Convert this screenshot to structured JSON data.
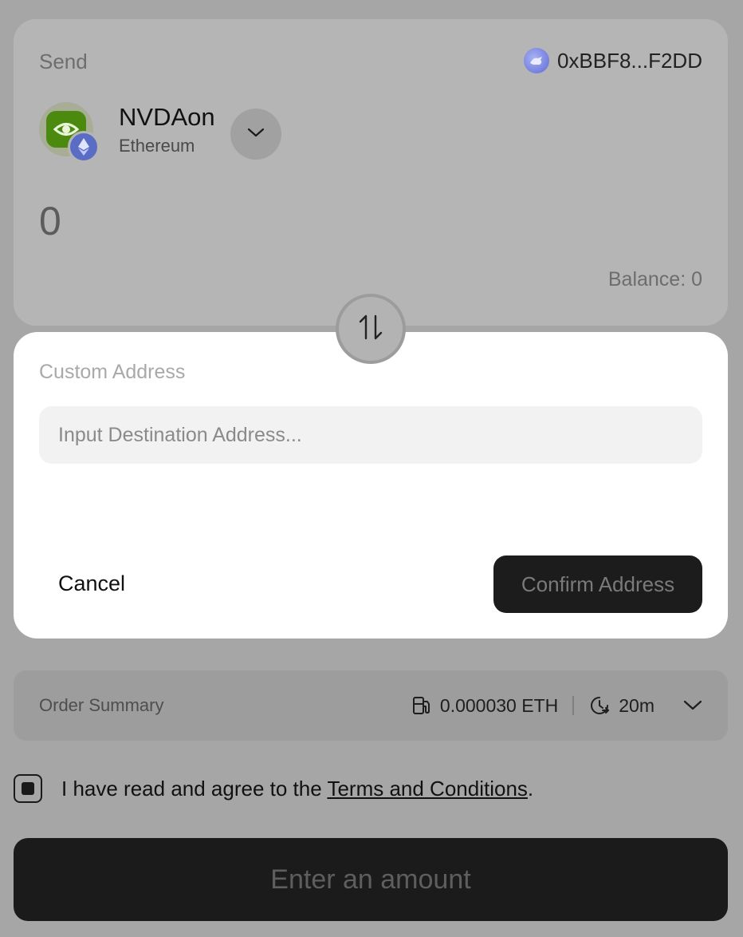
{
  "send": {
    "label": "Send",
    "wallet_address": "0xBBF8...F2DD",
    "token_symbol": "NVDAon",
    "token_chain": "Ethereum",
    "amount": "0",
    "balance": "Balance: 0"
  },
  "modal": {
    "title": "Custom Address",
    "input_placeholder": "Input Destination Address...",
    "input_value": "",
    "cancel_label": "Cancel",
    "confirm_label": "Confirm Address"
  },
  "order_summary": {
    "label": "Order Summary",
    "gas_fee": "0.000030 ETH",
    "time": "20m"
  },
  "terms": {
    "prefix": "I have read and agree to the ",
    "link_text": "Terms and Conditions",
    "suffix": "."
  },
  "primary_button": {
    "label": "Enter an amount"
  },
  "colors": {
    "overlay_background": "#a6a6a6",
    "modal_background": "#ffffff",
    "dark_button": "#1b1b1b",
    "token_green": "#4c8a0f",
    "ethereum_badge": "#5b6cc4"
  },
  "icons": [
    "wallet-avatar-icon",
    "nvidia-logo-icon",
    "ethereum-icon",
    "chevron-down-icon",
    "swap-arrows-icon",
    "gas-pump-icon",
    "clock-refresh-icon"
  ]
}
